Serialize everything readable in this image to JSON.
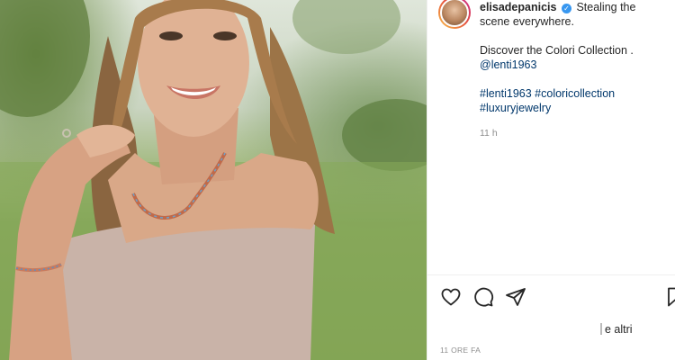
{
  "post": {
    "username": "elisadepanicis",
    "verified_mark": "✓",
    "caption_line1": "Stealing the scene everywhere.",
    "caption_line2": "Discover the Colori Collection .",
    "mention": "@lenti1963",
    "hashtags_line1": "#lenti1963 #coloricollection",
    "hashtags_line2": "#luxuryjewelry",
    "time_ago": "11 h",
    "likes_text": "e altri",
    "date_label": "11 ORE FA"
  },
  "icons": {
    "like": "heart-icon",
    "comment": "comment-icon",
    "share": "share-icon",
    "save": "bookmark-icon",
    "avatar": "avatar"
  },
  "colors": {
    "text": "#262626",
    "muted": "#8e8e8e",
    "link": "#00376b",
    "verified": "#3897f0"
  }
}
